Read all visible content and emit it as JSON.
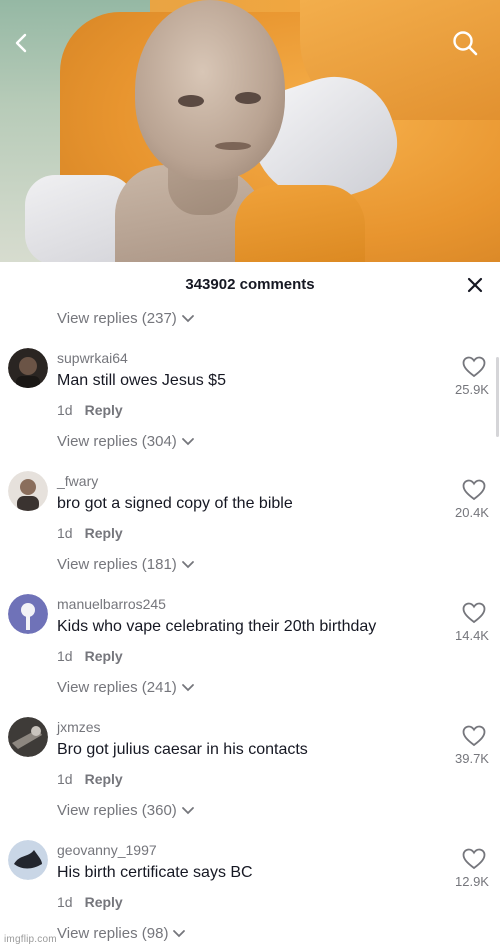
{
  "video": {
    "back_icon": "chevron-left-icon",
    "search_icon": "search-icon"
  },
  "comments_panel": {
    "count_label": "343902 comments",
    "close_icon": "close-icon",
    "top_view_replies": "View replies (237)",
    "comments": [
      {
        "username": "supwrkai64",
        "text": "Man still owes Jesus $5",
        "time": "1d",
        "reply_label": "Reply",
        "likes": "25.9K",
        "view_replies": "View replies (304)"
      },
      {
        "username": "_fwary",
        "text": "bro got a signed copy of the bible",
        "time": "1d",
        "reply_label": "Reply",
        "likes": "20.4K",
        "view_replies": "View replies (181)"
      },
      {
        "username": "manuelbarros245",
        "text": "Kids who vape celebrating their 20th birthday",
        "time": "1d",
        "reply_label": "Reply",
        "likes": "14.4K",
        "view_replies": "View replies (241)"
      },
      {
        "username": "jxmzes",
        "text": "Bro got julius caesar in his contacts",
        "time": "1d",
        "reply_label": "Reply",
        "likes": "39.7K",
        "view_replies": "View replies (360)"
      },
      {
        "username": "geovanny_1997",
        "text": "His birth certificate says BC",
        "time": "1d",
        "reply_label": "Reply",
        "likes": "12.9K",
        "view_replies": "View replies (98)"
      }
    ]
  },
  "watermark": "imgflip.com",
  "colors": {
    "secondary_text": "#75767c",
    "primary_text": "#161823",
    "robe_orange": "#f0a23a"
  }
}
